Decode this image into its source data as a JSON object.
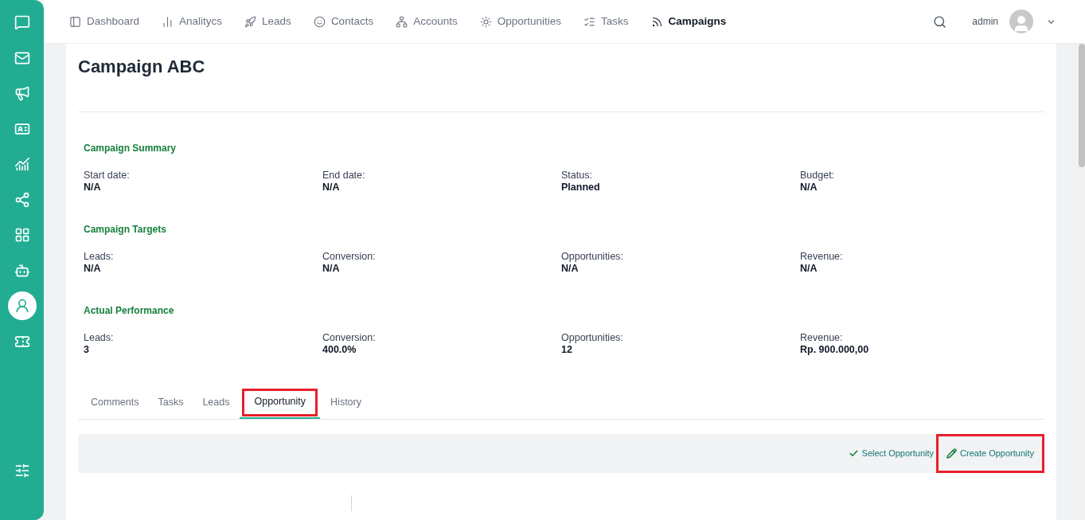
{
  "sidebar": {
    "items": [
      {
        "selected": false
      },
      {
        "selected": false
      },
      {
        "selected": false
      },
      {
        "selected": false
      },
      {
        "selected": false
      },
      {
        "selected": false
      },
      {
        "selected": false
      },
      {
        "selected": false
      },
      {
        "selected": true
      },
      {
        "selected": false
      }
    ]
  },
  "nav": {
    "items": [
      {
        "label": "Dashboard",
        "selected": false
      },
      {
        "label": "Analitycs",
        "selected": false
      },
      {
        "label": "Leads",
        "selected": false
      },
      {
        "label": "Contacts",
        "selected": false
      },
      {
        "label": "Accounts",
        "selected": false
      },
      {
        "label": "Opportunities",
        "selected": false
      },
      {
        "label": "Tasks",
        "selected": false
      },
      {
        "label": "Campaigns",
        "selected": true
      }
    ],
    "user": "admin"
  },
  "page": {
    "title": "Campaign ABC",
    "sections": [
      {
        "heading": "Campaign Summary",
        "fields": [
          {
            "label": "Start date:",
            "value": "N/A"
          },
          {
            "label": "End date:",
            "value": "N/A"
          },
          {
            "label": "Status:",
            "value": "Planned"
          },
          {
            "label": "Budget:",
            "value": "N/A"
          }
        ]
      },
      {
        "heading": "Campaign Targets",
        "fields": [
          {
            "label": "Leads:",
            "value": "N/A"
          },
          {
            "label": "Conversion:",
            "value": "N/A"
          },
          {
            "label": "Opportunities:",
            "value": "N/A"
          },
          {
            "label": "Revenue:",
            "value": "N/A"
          }
        ]
      },
      {
        "heading": "Actual Performance",
        "fields": [
          {
            "label": "Leads:",
            "value": "3"
          },
          {
            "label": "Conversion:",
            "value": "400.0%"
          },
          {
            "label": "Opportunities:",
            "value": "12"
          },
          {
            "label": "Revenue:",
            "value": "Rp. 900.000,00"
          }
        ]
      }
    ],
    "tabs": [
      {
        "label": "Comments",
        "selected": false,
        "highlighted": false
      },
      {
        "label": "Tasks",
        "selected": false,
        "highlighted": false
      },
      {
        "label": "Leads",
        "selected": false,
        "highlighted": false
      },
      {
        "label": "Opportunity",
        "selected": true,
        "highlighted": true
      },
      {
        "label": "History",
        "selected": false,
        "highlighted": false
      }
    ],
    "actions": [
      {
        "label": "Select Opportunity",
        "highlighted": false
      },
      {
        "label": "Create Opportunity",
        "highlighted": true
      }
    ]
  }
}
